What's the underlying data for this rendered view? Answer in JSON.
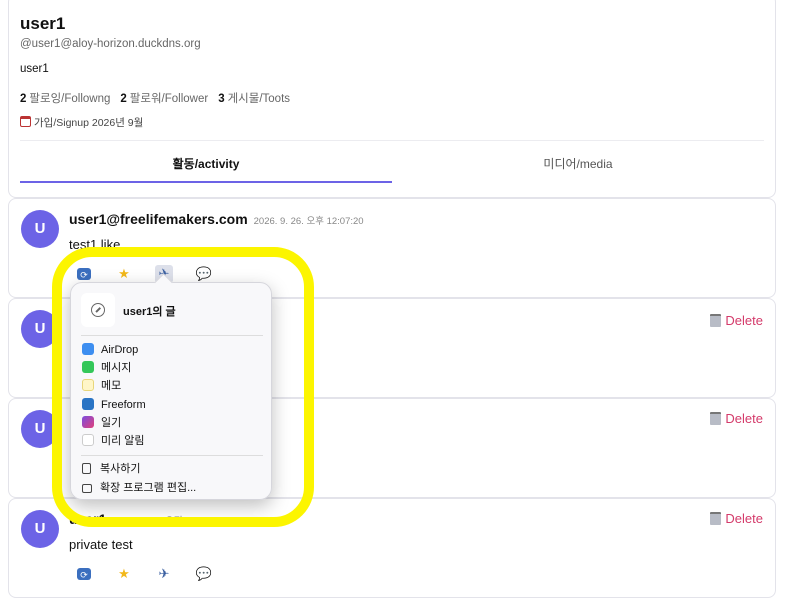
{
  "profile": {
    "name": "user1",
    "handle": "@user1@aloy-horizon.duckdns.org",
    "bio": "user1",
    "stats": {
      "following_count": "2",
      "following_label": "팔로잉/Followng",
      "followers_count": "2",
      "followers_label": "팔로워/Follower",
      "posts_count": "3",
      "posts_label": "게시물/Toots"
    },
    "signup": "가입/Signup 2026년 9월"
  },
  "tabs": {
    "activity": "활동/activity",
    "media": "미디어/media",
    "active": "activity"
  },
  "posts": [
    {
      "author": "user1@freelifemakers.com",
      "time": "2026. 9. 26. 오후 12:07:20",
      "body": "test1 like",
      "avatar": "U"
    },
    {
      "author": "",
      "time": "",
      "body": "",
      "avatar": "U",
      "delete_label": "Delete"
    },
    {
      "author": "",
      "time": "",
      "body": "",
      "avatar": "U",
      "delete_label": "Delete"
    },
    {
      "author": "user1",
      "time": "2026. 9. 25. 오전 10:28:07",
      "body": "private test",
      "avatar": "U",
      "delete_label": "Delete"
    }
  ],
  "share_menu": {
    "title": "user1의 글",
    "apps": [
      {
        "label": "AirDrop",
        "icon": "airdrop-icon"
      },
      {
        "label": "메시지",
        "icon": "messages-icon"
      },
      {
        "label": "메모",
        "icon": "notes-icon"
      },
      {
        "label": "Freeform",
        "icon": "freeform-icon"
      },
      {
        "label": "일기",
        "icon": "journal-icon"
      },
      {
        "label": "미리 알림",
        "icon": "reminders-icon"
      }
    ],
    "actions": [
      {
        "label": "복사하기",
        "icon": "copy-icon"
      },
      {
        "label": "확장 프로그램 편집...",
        "icon": "extensions-icon"
      }
    ]
  },
  "colors": {
    "accent": "#6c63e6",
    "delete": "#d43a6a",
    "highlight": "#fcf500"
  }
}
